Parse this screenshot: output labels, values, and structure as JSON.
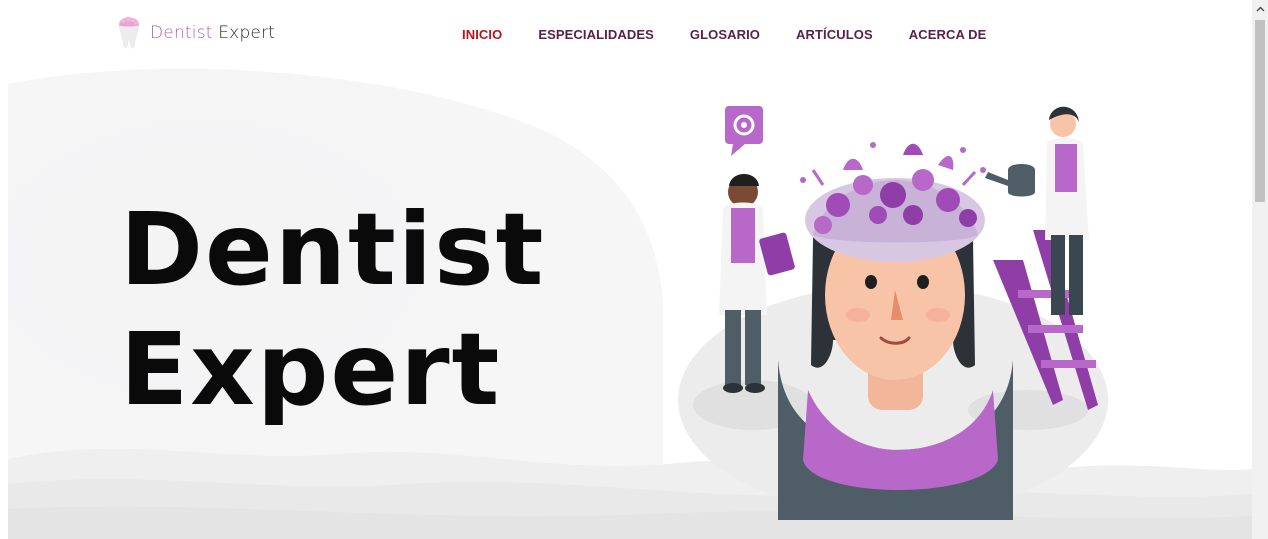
{
  "brand": {
    "name_part1": "Dentist",
    "name_part2": " Expert",
    "icon": "tooth-icon",
    "accent_color": "#b25fa8"
  },
  "nav": {
    "items": [
      {
        "label": "INICIO",
        "active": true
      },
      {
        "label": "ESPECIALIDADES",
        "active": false
      },
      {
        "label": "GLOSARIO",
        "active": false
      },
      {
        "label": "ARTÍCULOS",
        "active": false
      },
      {
        "label": "ACERCA DE",
        "active": false
      }
    ],
    "active_color": "#b5161e",
    "color": "#5a1f4a"
  },
  "hero": {
    "title_line1": "Dentist",
    "title_line2": "Expert",
    "illustration": "brain-garden-illustration"
  },
  "scrollbar": {
    "up_icon": "chevron-up-icon"
  }
}
